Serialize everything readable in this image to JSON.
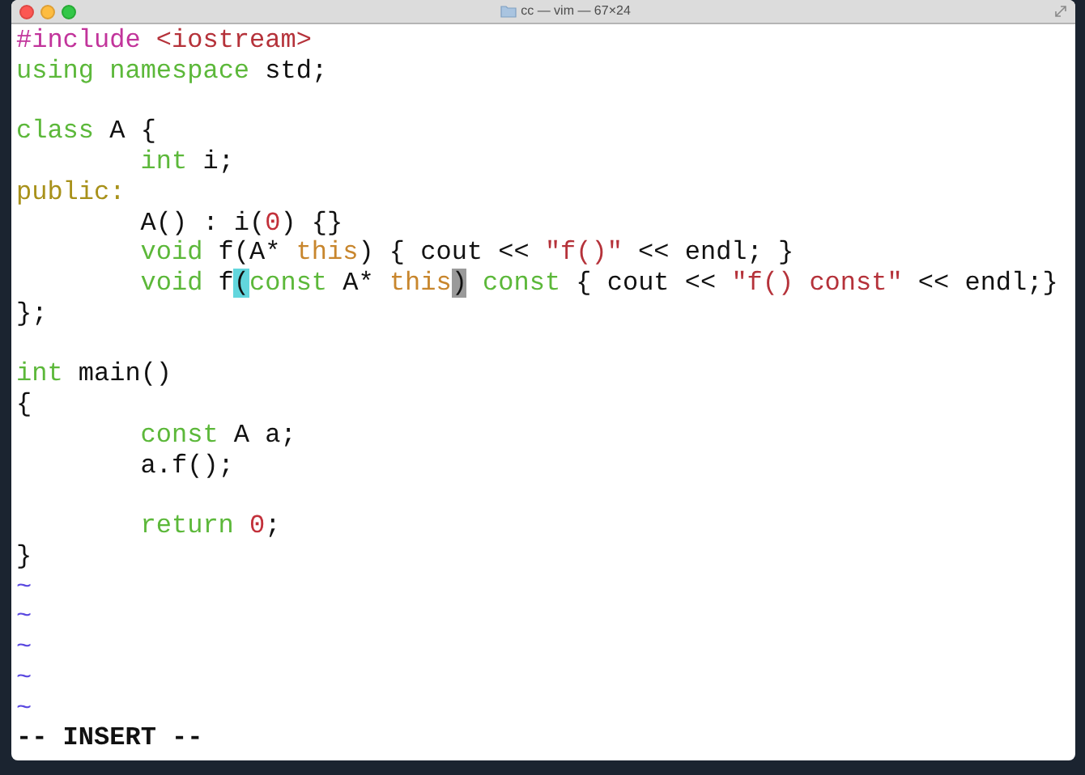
{
  "window": {
    "title": "cc — vim — 67×24"
  },
  "lines": [
    {
      "kind": "code",
      "indented": false,
      "tokens": [
        {
          "text": "#include ",
          "kind": "preproc"
        },
        {
          "text": "<iostream>",
          "kind": "string"
        }
      ]
    },
    {
      "kind": "code",
      "indented": false,
      "tokens": [
        {
          "text": "using namespace",
          "kind": "keyword"
        },
        {
          "text": " std;",
          "kind": "plain"
        }
      ]
    },
    {
      "kind": "blank"
    },
    {
      "kind": "code",
      "indented": false,
      "tokens": [
        {
          "text": "class",
          "kind": "keyword"
        },
        {
          "text": " A {",
          "kind": "plain"
        }
      ]
    },
    {
      "kind": "code",
      "indented": true,
      "tokens": [
        {
          "text": "int",
          "kind": "keyword"
        },
        {
          "text": " i;",
          "kind": "plain"
        }
      ]
    },
    {
      "kind": "code",
      "indented": false,
      "tokens": [
        {
          "text": "public:",
          "kind": "label"
        }
      ]
    },
    {
      "kind": "code",
      "indented": true,
      "tokens": [
        {
          "text": "A() : i(",
          "kind": "plain"
        },
        {
          "text": "0",
          "kind": "number"
        },
        {
          "text": ") {}",
          "kind": "plain"
        }
      ]
    },
    {
      "kind": "code",
      "indented": true,
      "tokens": [
        {
          "text": "void",
          "kind": "keyword"
        },
        {
          "text": " f(A* ",
          "kind": "plain"
        },
        {
          "text": "this",
          "kind": "this"
        },
        {
          "text": ") { cout << ",
          "kind": "plain"
        },
        {
          "text": "\"f()\"",
          "kind": "string"
        },
        {
          "text": " << endl; }",
          "kind": "plain"
        }
      ]
    },
    {
      "kind": "code",
      "indented": true,
      "tokens": [
        {
          "text": "void",
          "kind": "keyword"
        },
        {
          "text": " f",
          "kind": "plain"
        },
        {
          "text": "(",
          "kind": "match"
        },
        {
          "text": "const",
          "kind": "keyword"
        },
        {
          "text": " A* ",
          "kind": "plain"
        },
        {
          "text": "this",
          "kind": "this"
        },
        {
          "text": ")",
          "kind": "cursor"
        },
        {
          "text": " const",
          "kind": "keyword"
        },
        {
          "text": " { cout << ",
          "kind": "plain"
        },
        {
          "text": "\"f() const\"",
          "kind": "string"
        },
        {
          "text": " << endl;}",
          "kind": "plain"
        }
      ]
    },
    {
      "kind": "code",
      "indented": false,
      "tokens": [
        {
          "text": "};",
          "kind": "plain"
        }
      ]
    },
    {
      "kind": "blank"
    },
    {
      "kind": "code",
      "indented": false,
      "tokens": [
        {
          "text": "int",
          "kind": "keyword"
        },
        {
          "text": " main()",
          "kind": "plain"
        }
      ]
    },
    {
      "kind": "code",
      "indented": false,
      "tokens": [
        {
          "text": "{",
          "kind": "plain"
        }
      ]
    },
    {
      "kind": "code",
      "indented": true,
      "tokens": [
        {
          "text": "const",
          "kind": "keyword"
        },
        {
          "text": " A a;",
          "kind": "plain"
        }
      ]
    },
    {
      "kind": "code",
      "indented": true,
      "tokens": [
        {
          "text": "a.f();",
          "kind": "plain"
        }
      ]
    },
    {
      "kind": "blank"
    },
    {
      "kind": "code",
      "indented": true,
      "tokens": [
        {
          "text": "return ",
          "kind": "keyword"
        },
        {
          "text": "0",
          "kind": "number"
        },
        {
          "text": ";",
          "kind": "plain"
        }
      ]
    },
    {
      "kind": "code",
      "indented": false,
      "tokens": [
        {
          "text": "}",
          "kind": "plain"
        }
      ]
    }
  ],
  "filler_lines": [
    "~",
    "~",
    "~",
    "~",
    "~"
  ],
  "mode": "-- INSERT --"
}
